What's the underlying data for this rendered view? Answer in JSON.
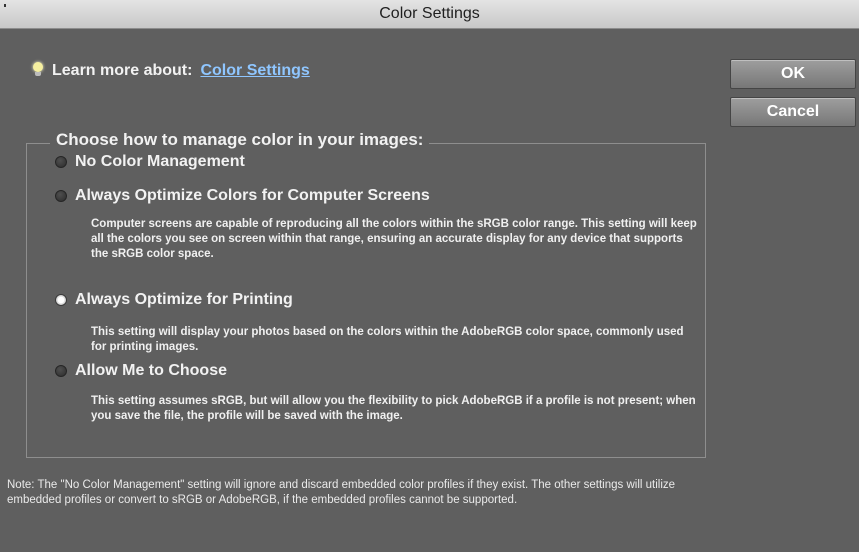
{
  "window": {
    "title": "Color Settings"
  },
  "learn": {
    "prefix": "Learn more about:",
    "link": "Color Settings"
  },
  "buttons": {
    "ok": "OK",
    "cancel": "Cancel"
  },
  "group": {
    "legend": "Choose how to manage color in your images:",
    "options": [
      {
        "label": "No Color Management",
        "selected": false,
        "description": ""
      },
      {
        "label": "Always Optimize Colors for Computer Screens",
        "selected": false,
        "description": "Computer screens are capable of reproducing all the colors within the sRGB color range. This setting will keep all the colors you see on screen within that range, ensuring an accurate display for any device that supports the sRGB color space."
      },
      {
        "label": "Always Optimize for Printing",
        "selected": true,
        "description": "This setting will display your photos based on the colors within the AdobeRGB color space, commonly used for printing images."
      },
      {
        "label": "Allow Me to Choose",
        "selected": false,
        "description": "This setting assumes sRGB, but will allow you the flexibility to pick AdobeRGB if a profile is not present; when you save the file, the profile will be saved with the image."
      }
    ]
  },
  "note": "Note: The \"No Color Management\" setting will ignore and discard embedded color profiles if they exist. The other settings will utilize embedded profiles or convert to sRGB or AdobeRGB, if the embedded profiles cannot be supported.",
  "icons": {
    "info": "lightbulb-icon",
    "radio_on": "radio-selected-icon",
    "radio_off": "radio-unselected-icon"
  },
  "colors": {
    "background": "#5f5f5f",
    "link": "#8fc6ff",
    "titlebar": "#d6d6d6"
  }
}
